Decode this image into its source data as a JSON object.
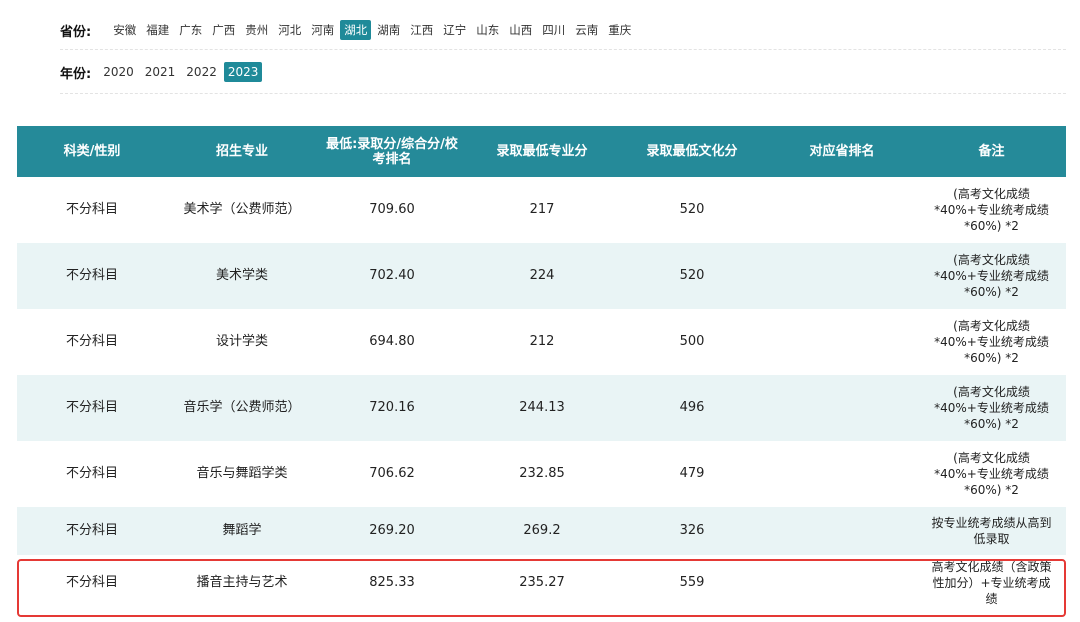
{
  "filters": {
    "province_label": "省份:",
    "provinces": [
      "安徽",
      "福建",
      "广东",
      "广西",
      "贵州",
      "河北",
      "河南",
      "湖北",
      "湖南",
      "江西",
      "辽宁",
      "山东",
      "山西",
      "四川",
      "云南",
      "重庆"
    ],
    "province_selected": "湖北",
    "year_label": "年份:",
    "years": [
      "2020",
      "2021",
      "2022",
      "2023"
    ],
    "year_selected": "2023"
  },
  "table": {
    "headers": [
      "科类/性别",
      "招生专业",
      "最低:录取分/综合分/校考排名",
      "录取最低专业分",
      "录取最低文化分",
      "对应省排名",
      "备注"
    ],
    "rows": [
      {
        "category": "不分科目",
        "major": "美术学（公费师范）",
        "min_score": "709.60",
        "min_major": "217",
        "min_culture": "520",
        "rank": "",
        "note": "(高考文化成绩*40%+专业统考成绩*60%) *2"
      },
      {
        "category": "不分科目",
        "major": "美术学类",
        "min_score": "702.40",
        "min_major": "224",
        "min_culture": "520",
        "rank": "",
        "note": "(高考文化成绩*40%+专业统考成绩*60%) *2"
      },
      {
        "category": "不分科目",
        "major": "设计学类",
        "min_score": "694.80",
        "min_major": "212",
        "min_culture": "500",
        "rank": "",
        "note": "(高考文化成绩*40%+专业统考成绩*60%) *2"
      },
      {
        "category": "不分科目",
        "major": "音乐学（公费师范）",
        "min_score": "720.16",
        "min_major": "244.13",
        "min_culture": "496",
        "rank": "",
        "note": "(高考文化成绩*40%+专业统考成绩*60%) *2"
      },
      {
        "category": "不分科目",
        "major": "音乐与舞蹈学类",
        "min_score": "706.62",
        "min_major": "232.85",
        "min_culture": "479",
        "rank": "",
        "note": "(高考文化成绩*40%+专业统考成绩*60%) *2"
      },
      {
        "category": "不分科目",
        "major": "舞蹈学",
        "min_score": "269.20",
        "min_major": "269.2",
        "min_culture": "326",
        "rank": "",
        "note": "按专业统考成绩从高到低录取"
      },
      {
        "category": "不分科目",
        "major": "播音主持与艺术",
        "min_score": "825.33",
        "min_major": "235.27",
        "min_culture": "559",
        "rank": "",
        "note": "高考文化成绩（含政策性加分）+专业统考成绩"
      }
    ]
  },
  "colors": {
    "header_bg": "#258a99",
    "active_filter": "#1f8a99",
    "alt_row": "#e9f4f5",
    "highlight": "#e53935"
  }
}
